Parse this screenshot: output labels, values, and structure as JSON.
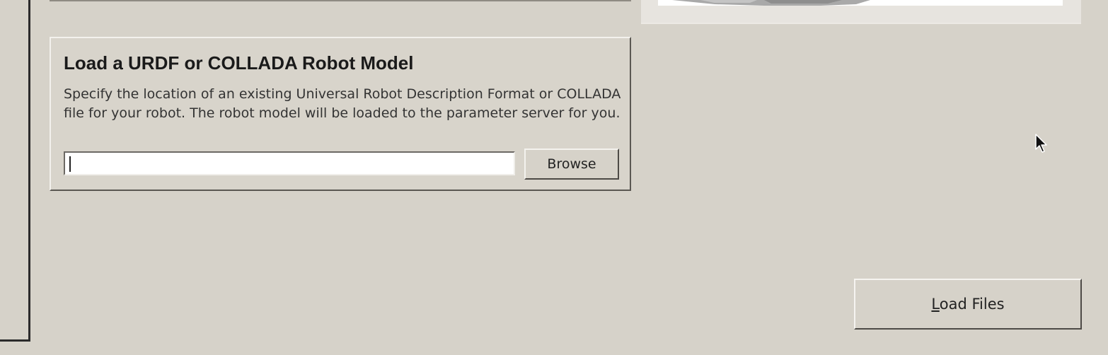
{
  "load_panel": {
    "title": "Load a URDF or COLLADA Robot Model",
    "description": "Specify the location of an existing Universal Robot Description Format or COLLADA file for your robot. The robot model will be loaded to the parameter server for you.",
    "path_value": "",
    "browse_label": "Browse"
  },
  "actions": {
    "load_files_mnemonic": "L",
    "load_files_rest": "oad Files"
  },
  "icons": {
    "cursor": "mouse-pointer-icon"
  }
}
